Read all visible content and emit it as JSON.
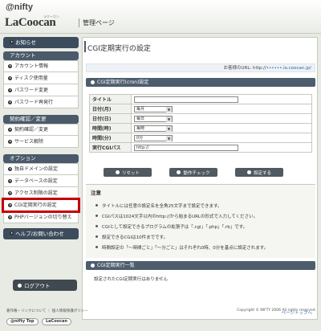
{
  "header": {
    "brand_top": "@nifty",
    "brand_kana": "ラクーカン",
    "brand_name": "LaCoocan",
    "section_title": "管理ページ"
  },
  "sidebar": {
    "notice": "お知らせ",
    "account_header": "アカウント",
    "account_items": [
      "アカウント情報",
      "ディスク使用量",
      "パスワード変更",
      "パスワード再発行"
    ],
    "contract_header": "契約確認／変更",
    "contract_items": [
      "契約確認／変更",
      "サービス解除"
    ],
    "option_header": "オプション",
    "option_items": [
      "独自ドメインの設定",
      "データベースの設定",
      "アクセス制限の設定",
      "CGI定期実行の設定",
      "PHPバージョンの切り替え"
    ],
    "help": "ヘルプ/お問い合わせ",
    "logout": "ログアウト"
  },
  "main": {
    "title": "CGI定期実行の設定",
    "url_label": "お客様のURL: http://",
    "url_masked": "••••••",
    "url_suffix": ".la.coocan.jp/",
    "form_bar": "CGI定期実行(cron)設定",
    "form": {
      "title_label": "タイトル",
      "title_value": "",
      "month_label": "日付(月)",
      "month_value": "毎月",
      "day_label": "日付(日)",
      "day_value": "毎日",
      "hour_label": "時間(時)",
      "hour_value": "毎時",
      "minute_label": "時間(分)",
      "minute_value": "0分",
      "path_label": "実行CGIパス",
      "path_value": "http://"
    },
    "buttons": {
      "reset": "リセット",
      "check": "動作チェック",
      "submit": "設定する"
    },
    "note_header": "注意",
    "notes": [
      "タイトルには任意の設定名を全角25文字まで設定できます。",
      "CGIパスは1024文字以内のhttp://から始まるURLの形式で入力してください。",
      "CGIとして設定できるプログラムの拡張子は「.cgi」「.php」「.rb」です。",
      "設定できるCGIは10件までです。",
      "時間設定の「〜時間ごと」「〜分ごと」はそれぞれ0時、0分を基点に設定されます。"
    ],
    "list_bar": "CGI定期実行一覧",
    "no_data": "設定されたCGI定期実行はありません",
    "page_top": "ページトップへ"
  },
  "footer": {
    "links": "著作権・リンクについて ｜ 個人情報保護ポリシー",
    "copyright": "Copyright © NIFTY 2006 All rights reserved.",
    "logo1": "@nifty Top",
    "logo2": "LaCoocan"
  }
}
